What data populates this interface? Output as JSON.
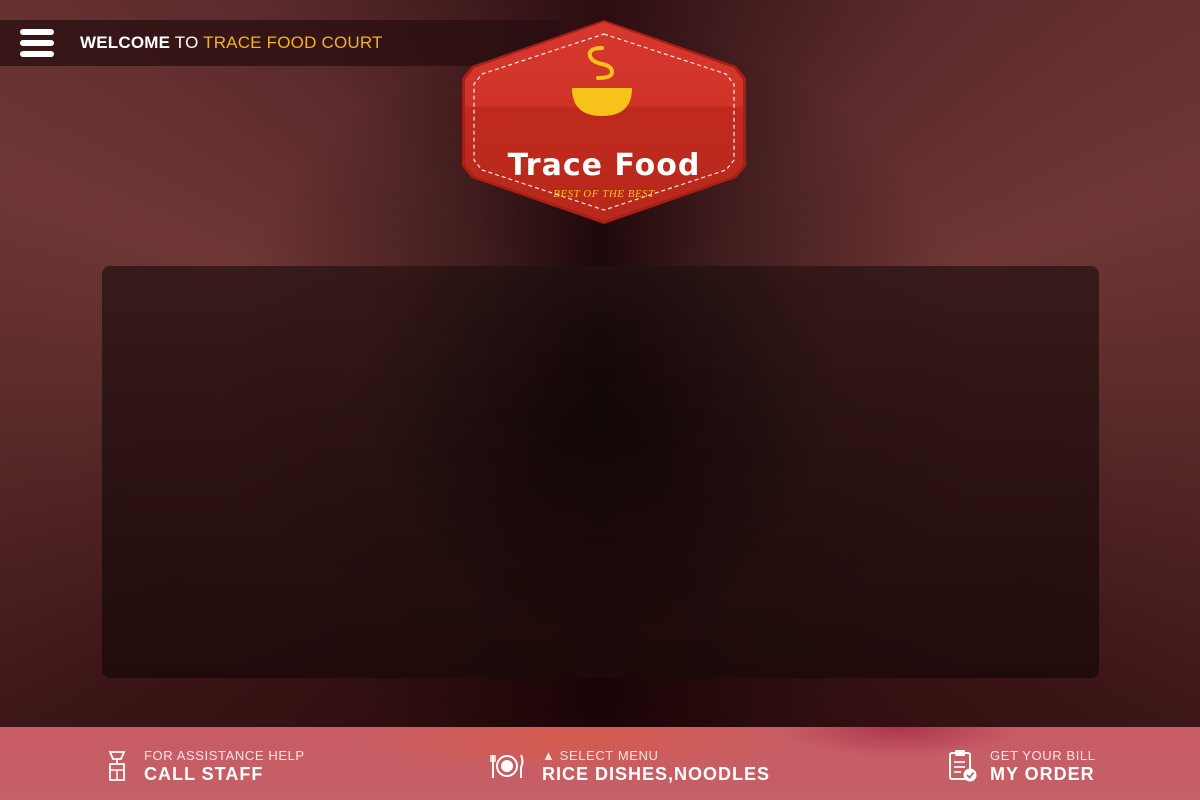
{
  "header": {
    "menu_icon": "hamburger-menu-icon",
    "welcome_part1": "WELCOME",
    "welcome_part2": " TO ",
    "welcome_part3": "TRACE FOOD COURT"
  },
  "logo": {
    "title": "Trace Food",
    "tagline": "BEST OF THE BEST",
    "icon": "soup-bowl-icon"
  },
  "footer": {
    "call_staff": {
      "caption": "FOR ASSISTANCE HELP",
      "label": "CALL STAFF",
      "icon": "bell-icon"
    },
    "select_menu": {
      "caption": "▲ SELECT MENU",
      "label": "RICE DISHES,NOODLES",
      "icon": "plate-cutlery-icon"
    },
    "my_order": {
      "caption": "GET YOUR BILL",
      "label": "MY ORDER",
      "icon": "clipboard-check-icon"
    }
  },
  "colors": {
    "accent": "#f4b21b",
    "badge_red": "#cc3026",
    "footer_bg": "#c85c64"
  }
}
